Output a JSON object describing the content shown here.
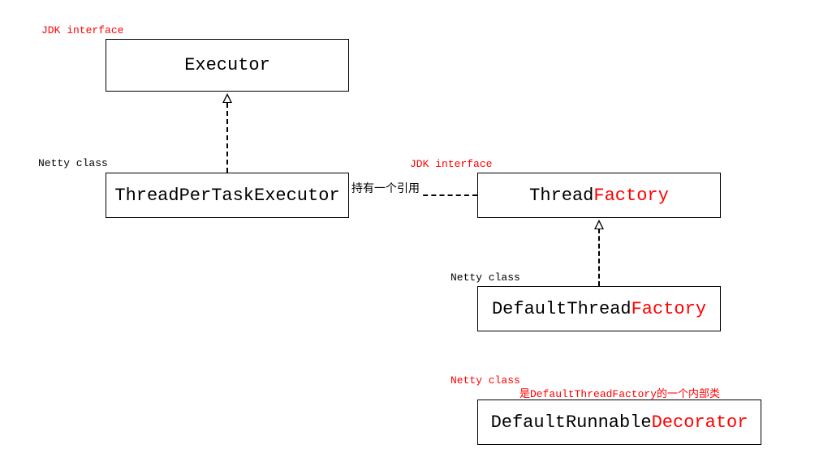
{
  "labels": {
    "jdk_interface_1": "JDK interface",
    "netty_class_1": "Netty class",
    "jdk_interface_2": "JDK interface",
    "netty_class_2": "Netty class",
    "netty_class_3": "Netty class",
    "inner_class_note": "是DefaultThreadFactory的一个内部类"
  },
  "boxes": {
    "executor": "Executor",
    "threadPerTaskExecutor": "ThreadPerTaskExecutor",
    "threadFactory_prefix": "Thread",
    "threadFactory_suffix": "Factory",
    "defaultThreadFactory_prefix": "DefaultThread",
    "defaultThreadFactory_suffix": "Factory",
    "defaultRunnableDecorator_prefix": "DefaultRunnable",
    "defaultRunnableDecorator_suffix": "Decorator"
  },
  "relations": {
    "has_reference": "持有一个引用"
  }
}
